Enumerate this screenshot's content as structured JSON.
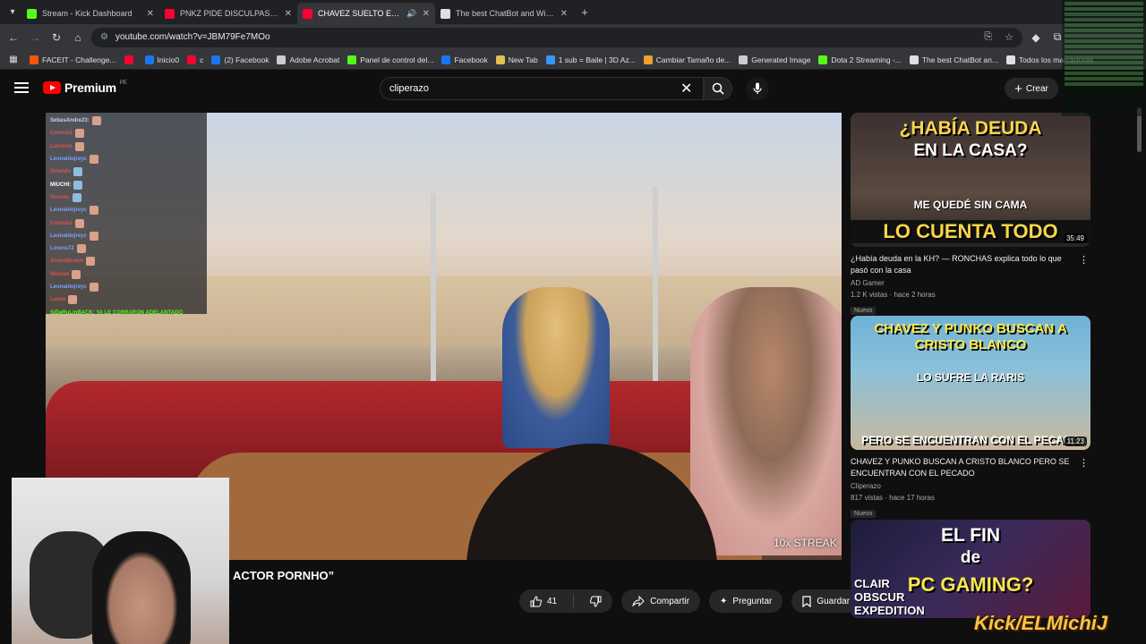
{
  "tabs": [
    {
      "title": "Stream - Kick Dashboard",
      "color": "#53fc18",
      "active": false
    },
    {
      "title": "PNKZ PIDE DISCULPAS A SU FA",
      "color": "#ff0033",
      "active": false
    },
    {
      "title": "CHAVEZ SUELTO EN PLAZA",
      "color": "#ff0033",
      "active": true
    },
    {
      "title": "The best ChatBot and Widgets",
      "color": "#e0e0e0",
      "active": false
    }
  ],
  "address": {
    "url": "youtube.com/watch?v=JBM79Fe7MOo"
  },
  "bookmarks": [
    {
      "label": "FACEIT - Challenge...",
      "color": "#ff5500"
    },
    {
      "label": "",
      "color": "#ff0033"
    },
    {
      "label": "Inicio0",
      "color": "#1877f2"
    },
    {
      "label": "c",
      "color": "#ff0033"
    },
    {
      "label": "(2) Facebook",
      "color": "#1877f2"
    },
    {
      "label": "Adobe Acrobat",
      "color": "#cccccc"
    },
    {
      "label": "Panel de control del...",
      "color": "#53fc18"
    },
    {
      "label": "Facebook",
      "color": "#1877f2"
    },
    {
      "label": "New Tab",
      "color": "#e0c050"
    },
    {
      "label": "1 sub = Baile | 3D Az...",
      "color": "#3399ff"
    },
    {
      "label": "Cambiar Tamaño de...",
      "color": "#f0a030"
    },
    {
      "label": "Generated Image",
      "color": "#cccccc"
    },
    {
      "label": "Dota 2 Streaming -...",
      "color": "#53fc18"
    },
    {
      "label": "The best ChatBot an...",
      "color": "#e0e0e0"
    },
    {
      "label": "Todos los marcadores",
      "color": "#e0e0e0"
    }
  ],
  "youtube": {
    "logo": "Premium",
    "country": "PE",
    "search_value": "cliperazo",
    "create_label": "Crear"
  },
  "chat": [
    {
      "name": "SebasAndre23:",
      "color": "#c6d0e8",
      "emote": "face"
    },
    {
      "name": "Comsia1",
      "color": "#e05050",
      "emote": "face"
    },
    {
      "name": "Lucrecia",
      "color": "#e05050",
      "emote": "face"
    },
    {
      "name": "Leonaldojreyc",
      "color": "#7aa0ff",
      "emote": "face"
    },
    {
      "name": "Orlando",
      "color": "#e05050",
      "emote": "bird"
    },
    {
      "name": "MIUCHI:",
      "color": "#ffffff",
      "emote": "bird"
    },
    {
      "name": "Vicento",
      "color": "#e05050",
      "emote": "bird"
    },
    {
      "name": "Leonaldojreyc",
      "color": "#7aa0ff",
      "emote": "face"
    },
    {
      "name": "Comsia1",
      "color": "#e05050",
      "emote": "face"
    },
    {
      "name": "Leonaldojreyc",
      "color": "#7aa0ff",
      "emote": "face"
    },
    {
      "name": "Lorens72",
      "color": "#7aa0ff",
      "emote": "face"
    },
    {
      "name": "AlvaroBrown",
      "color": "#e05050",
      "emote": "face"
    },
    {
      "name": "Nicolas",
      "color": "#e05050",
      "emote": "face"
    },
    {
      "name": "Leonaldojreyc",
      "color": "#7aa0ff",
      "emote": "face"
    },
    {
      "name": "Lucas",
      "color": "#e05050",
      "emote": "face"
    },
    {
      "name": "SiDeRuLinBACK: YA LE CORRARON ADELANTADO",
      "color": "#53fc18",
      "emote": "none"
    }
  ],
  "video": {
    "streak": "10x STREAK",
    "title_tail": "ACTOR PORNHO”",
    "like_count": "41",
    "share_label": "Compartir",
    "ask_label": "Preguntar",
    "save_label": "Guardar"
  },
  "related": [
    {
      "thumb_line1": "¿HABÍA DEUDA",
      "thumb_line2": "EN LA CASA?",
      "thumb_line3": "LO CUENTA TODO",
      "thumb_extra": "ME QUEDÉ SIN CAMA",
      "duration": "35:49",
      "title": "¿Había deuda en la KH? — RONCHAS explica todo lo que pasó con la casa",
      "channel": "AD Gamer",
      "stats": "1.2 K vistas · hace 2 horas",
      "badge": "Nuevo"
    },
    {
      "thumb_line1": "CHAVEZ Y PUNKO BUSCAN A",
      "thumb_line2": "CRISTO BLANCO",
      "thumb_line3": "PERO SE ENCUENTRAN CON EL PECADO",
      "thumb_extra": "LO SUFRE LA RARIS",
      "duration": "11:23",
      "title": "CHAVEZ Y PUNKO BUSCAN A CRISTO BLANCO PERO SE ENCUENTRAN CON EL PECADO",
      "channel": "Cliperazo",
      "stats": "817 vistas · hace 17 horas",
      "badge": "Nuevo"
    },
    {
      "thumb_line1": "EL FIN",
      "thumb_line2": "de",
      "thumb_line3": "PC GAMING?",
      "thumb_extra": "CLAIR OBSCUR EXPEDITION",
      "duration": "",
      "title": "",
      "channel": "",
      "stats": "",
      "badge": ""
    }
  ],
  "overlay_brand": "Kick/ELMichiJ"
}
